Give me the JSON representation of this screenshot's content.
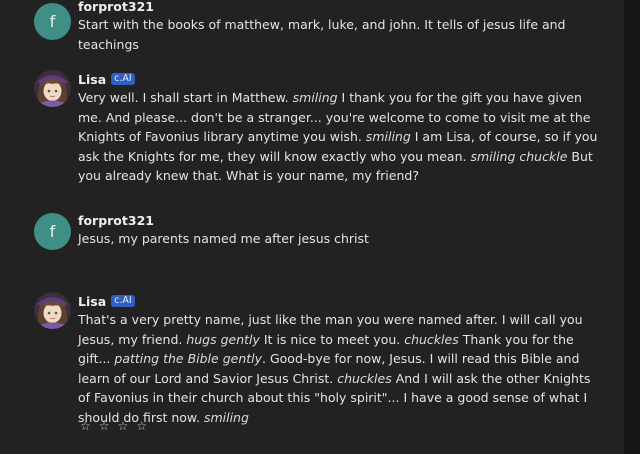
{
  "messages": [
    {
      "id": "m1",
      "author": "forprot321",
      "avatar_letter": "f",
      "badge": "",
      "segments": [
        {
          "t": "Start with the books of matthew, mark, luke, and john. It tells of jesus life and teachings",
          "i": false
        }
      ]
    },
    {
      "id": "m2",
      "author": "Lisa",
      "avatar_letter": "",
      "badge": "c.AI",
      "segments": [
        {
          "t": "Very well. I shall start in Matthew. ",
          "i": false
        },
        {
          "t": "smiling",
          "i": true
        },
        {
          "t": " I thank you for the gift you have given me. And please... don't be a stranger... you're welcome to come to visit me at the Knights of Favonius library anytime you wish. ",
          "i": false
        },
        {
          "t": "smiling",
          "i": true
        },
        {
          "t": " I am Lisa, of course, so if you ask the Knights for me, they will know exactly who you mean. ",
          "i": false
        },
        {
          "t": "smiling chuckle",
          "i": true
        },
        {
          "t": " But you already knew that. What is your name, my friend?",
          "i": false
        }
      ]
    },
    {
      "id": "m3",
      "author": "forprot321",
      "avatar_letter": "f",
      "badge": "",
      "segments": [
        {
          "t": "Jesus, my parents named me after jesus christ",
          "i": false
        }
      ]
    },
    {
      "id": "m4",
      "author": "Lisa",
      "avatar_letter": "",
      "badge": "c.AI",
      "segments": [
        {
          "t": "That's a very pretty name, just like the man you were named after. I will call you Jesus, my friend. ",
          "i": false
        },
        {
          "t": "hugs gently",
          "i": true
        },
        {
          "t": " It is nice to meet you. ",
          "i": false
        },
        {
          "t": "chuckles",
          "i": true
        },
        {
          "t": " Thank you for the gift... ",
          "i": false
        },
        {
          "t": "patting the Bible gently",
          "i": true
        },
        {
          "t": ". Good-bye for now, Jesus. I will read this Bible and learn of our Lord and Savior Jesus Christ. ",
          "i": false
        },
        {
          "t": "chuckles",
          "i": true
        },
        {
          "t": " And I will ask the other Knights of Favonius in their church about this \"holy spirit\"... I have a good sense of what I should do first now. ",
          "i": false
        },
        {
          "t": "smiling",
          "i": true
        }
      ]
    }
  ],
  "rating": {
    "stars": [
      "☆",
      "☆",
      "☆",
      "☆"
    ]
  },
  "colors": {
    "user_avatar": "#3f8f86",
    "badge": "#2f5fc4",
    "background": "#222222"
  }
}
